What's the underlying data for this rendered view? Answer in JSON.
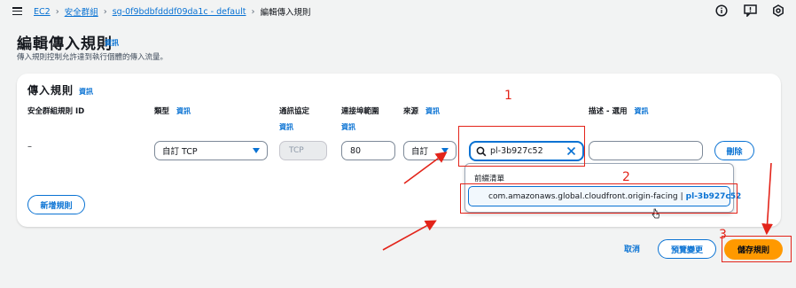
{
  "breadcrumb": {
    "items": [
      "EC2",
      "安全群組",
      "sg-0f9bdbfdddf09da1c - default",
      "編輯傳入規則"
    ]
  },
  "page": {
    "title": "編輯傳入規則",
    "info": "資訊",
    "description": "傳入規則控制允許達到執行個體的傳入流量。"
  },
  "rules_panel": {
    "title": "傳入規則",
    "info": "資訊",
    "columns": {
      "rule_id": "安全群組規則 ID",
      "type": "類型",
      "protocol": "通訊協定",
      "port_range": "連接埠範圍",
      "source": "來源",
      "description": "描述 - 選用"
    },
    "info_link": "資訊",
    "rule": {
      "rule_id": "–",
      "type": "自訂 TCP",
      "protocol": "TCP",
      "port_range": "80",
      "source_type": "自訂",
      "source_search": "pl-3b927c52",
      "description": "",
      "delete_label": "刪除"
    },
    "add_rule_label": "新增規則"
  },
  "source_dropdown": {
    "header": "前綴清單",
    "option_name": "com.amazonaws.global.cloudfront.origin-facing",
    "option_separator": "|",
    "option_id": "pl-3b927c52"
  },
  "footer": {
    "cancel_label": "取消",
    "preview_label": "預覽變更",
    "save_label": "儲存規則"
  },
  "annotations": {
    "step1": "1",
    "step2": "2",
    "step3": "3",
    "color": "#e3241a"
  },
  "colors": {
    "accent": "#0972d3",
    "primary_button": "#ff9900",
    "background": "#f2f3f3"
  }
}
